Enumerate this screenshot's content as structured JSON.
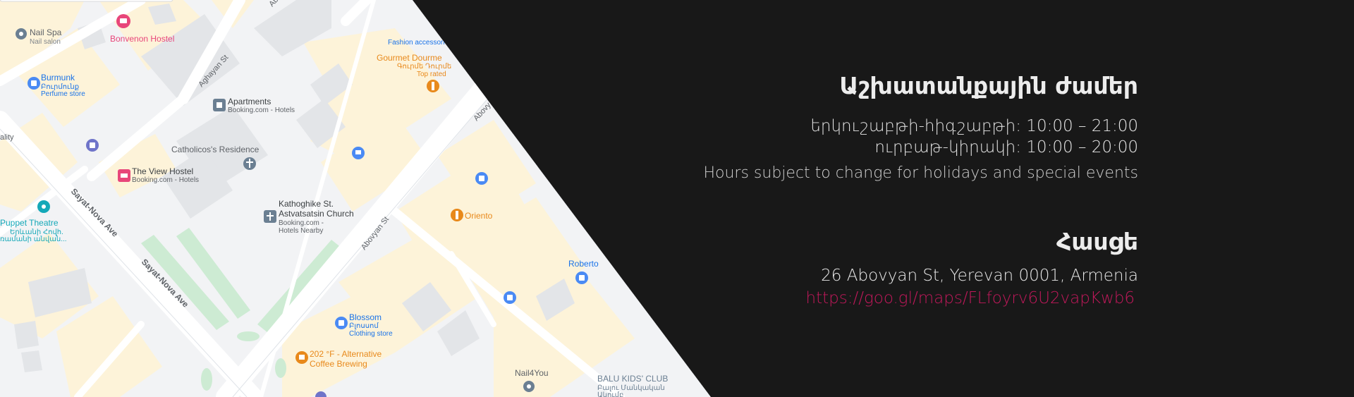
{
  "hours": {
    "title": "Աշխատանքային ժամեր",
    "weekdays": "երկուշաբթի-հիգշաբթի: 10:00 – 21:00",
    "weekend": "ուրբաթ-կիրակի: 10:00 – 20:00",
    "note": "Hours subject to change for holidays and special events"
  },
  "address": {
    "title": "Հասցե",
    "street": "26 Abovyan St, Yerevan 0001, Armenia",
    "map_link": "https://goo.gl/maps/FLfoyrv6U2vapKwb6"
  },
  "map": {
    "streets": {
      "aghayan": "Aghayan St",
      "abovyan_top": "Abovy",
      "abovyan_mid": "Abovyan St",
      "sayat_nova_1": "Sayat-Nova Ave",
      "sayat_nova_2": "Sayat-Nova Ave",
      "top_fragment": "Ab"
    },
    "places": {
      "nail_spa": {
        "name": "Nail Spa",
        "sub": "Nail salon"
      },
      "bonvenon": {
        "name": "Bonvenon Hostel"
      },
      "burmunk": {
        "name": "Burmunk",
        "sub1": "Բուրմունք",
        "sub2": "Perfume store"
      },
      "apartments": {
        "name": "Apartments",
        "sub": "Booking.com - Hotels"
      },
      "gourmet": {
        "name": "Gourmet Dourme",
        "sub1": "Գուրմե Դուրմե",
        "sub2": "Top rated"
      },
      "fashion": {
        "name": "Fashion accessori"
      },
      "quality": {
        "name": "ality"
      },
      "catholicos": {
        "name": "Catholicos's Residence"
      },
      "view_hostel": {
        "name": "The View Hostel",
        "sub": "Booking.com - Hotels"
      },
      "kathoghike": {
        "name1": "Kathoghike St.",
        "name2": "Astvatsatsin Church",
        "sub1": "Booking.com -",
        "sub2": "Hotels Nearby"
      },
      "puppet": {
        "name": "Puppet Theatre",
        "sub1": "Երևանի Հովհ.",
        "sub2": "ռամանի անվան..."
      },
      "oriento": {
        "name": "Oriento"
      },
      "roberto": {
        "name": "Roberto"
      },
      "blossom": {
        "name": "Blossom",
        "sub1": "Բլոսսոմ",
        "sub2": "Clothing store"
      },
      "coffee": {
        "name1": "202 °F - Alternative",
        "name2": "Coffee Brewing"
      },
      "nail4you": {
        "name": "Nail4You"
      },
      "balu": {
        "name": "BALU KIDS' CLUB",
        "sub1": "Բալու Մանկական",
        "sub2": "Ակումբ"
      }
    }
  },
  "colors": {
    "background": "#181818",
    "map_base": "#f2f3f5",
    "block": "#fdf3d9",
    "building": "#e3e5e8",
    "park": "#cdebd3",
    "road": "#ffffff",
    "link": "#c2185b",
    "pin_blue": "#4a8af4",
    "pin_orange": "#e8891b",
    "pin_pink": "#e8467a",
    "pin_teal": "#14a8b8",
    "pin_gray": "#6b7f92"
  }
}
